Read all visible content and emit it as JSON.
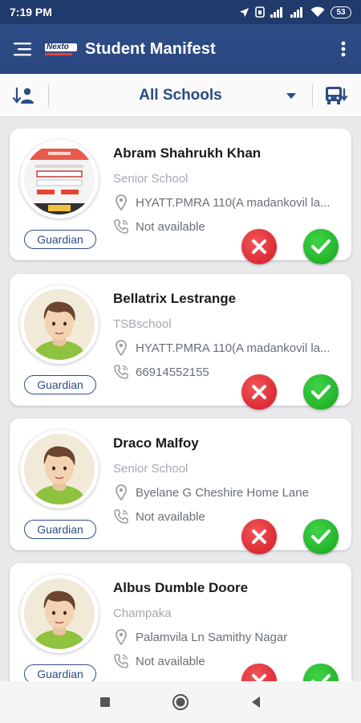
{
  "status_bar": {
    "time": "7:19 PM",
    "battery": "53",
    "icons": [
      "navigation-icon",
      "sim-icon",
      "signal-icon",
      "signal-icon",
      "wifi-icon",
      "battery-icon"
    ]
  },
  "app_bar": {
    "logo_text": "Nexto",
    "title": "Student Manifest",
    "colors": {
      "primary": "#2e4d87",
      "status_bar": "#203a6b"
    }
  },
  "filter_bar": {
    "selected_school": "All Schools"
  },
  "students": [
    {
      "name": "Abram Shahrukh Khan",
      "school": "Senior School",
      "address": "HYATT.PMRA 110(A madankovil la...",
      "phone": "Not available",
      "guardian_label": "Guardian",
      "avatar": "screenshot-photo"
    },
    {
      "name": "Bellatrix Lestrange",
      "school": "TSBschool",
      "address": "HYATT.PMRA 110(A madankovil la...",
      "phone": "66914552155",
      "guardian_label": "Guardian",
      "avatar": "default-boy-avatar"
    },
    {
      "name": "Draco Malfoy",
      "school": "Senior School",
      "address": "Byelane G  Cheshire Home Lane",
      "phone": "Not available",
      "guardian_label": "Guardian",
      "avatar": "default-boy-avatar"
    },
    {
      "name": "Albus Dumble Doore",
      "school": "Champaka",
      "address": "Palamvila Ln  Samithy Nagar",
      "phone": "Not available",
      "guardian_label": "Guardian",
      "avatar": "default-boy-avatar"
    }
  ]
}
